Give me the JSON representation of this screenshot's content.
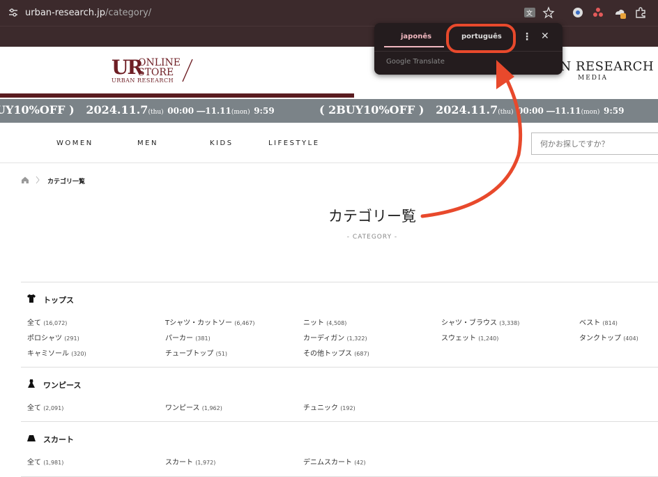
{
  "browser": {
    "url_host": "urban-research.jp",
    "url_path": "/category/"
  },
  "translate_popup": {
    "tab_source": "japonês",
    "tab_target": "português",
    "footer": "Google Translate"
  },
  "header": {
    "logo_ur": "UR",
    "logo_line1": "ONLINE",
    "logo_line2": "STORE",
    "logo_line3": "URBAN RESEARCH",
    "media_title": "AN RESEARCH",
    "media_sub": "MEDIA"
  },
  "banner": {
    "item1_a": "UY10%OFF )",
    "item1_b": "2024.11.7",
    "item1_c": "(thu)",
    "item1_d": "00:00 ―11.11",
    "item1_e": "(mon)",
    "item1_f": "9:59",
    "item2_a": "( 2BUY10%OFF )",
    "item2_b": "2024.11.7",
    "item2_c": "(thu)",
    "item2_d": "00:00 ―11.11",
    "item2_e": "(mon)",
    "item2_f": "9:59"
  },
  "nav": {
    "items": [
      "WOMEN",
      "MEN",
      "KIDS",
      "LIFESTYLE"
    ],
    "search_placeholder": "何かお探しですか？"
  },
  "breadcrumb": {
    "current": "カテゴリ一覧"
  },
  "page": {
    "title": "カテゴリー覧",
    "subtitle": "- CATEGORY -"
  },
  "sections": [
    {
      "title": "トップス",
      "links": [
        {
          "label": "全て",
          "count": "(16,072)"
        },
        {
          "label": "Tシャツ・カットソー",
          "count": "(6,467)"
        },
        {
          "label": "ニット",
          "count": "(4,508)"
        },
        {
          "label": "シャツ・ブラウス",
          "count": "(3,338)"
        },
        {
          "label": "ベスト",
          "count": "(814)"
        },
        {
          "label": "ポロシャツ",
          "count": "(291)"
        },
        {
          "label": "パーカー",
          "count": "(381)"
        },
        {
          "label": "カーディガン",
          "count": "(1,322)"
        },
        {
          "label": "スウェット",
          "count": "(1,240)"
        },
        {
          "label": "タンクトップ",
          "count": "(404)"
        },
        {
          "label": "キャミソール",
          "count": "(320)"
        },
        {
          "label": "チューブトップ",
          "count": "(51)"
        },
        {
          "label": "その他トップス",
          "count": "(687)"
        }
      ]
    },
    {
      "title": "ワンピース",
      "links": [
        {
          "label": "全て",
          "count": "(2,091)"
        },
        {
          "label": "ワンピース",
          "count": "(1,962)"
        },
        {
          "label": "チュニック",
          "count": "(192)"
        }
      ]
    },
    {
      "title": "スカート",
      "links": [
        {
          "label": "全て",
          "count": "(1,981)"
        },
        {
          "label": "スカート",
          "count": "(1,972)"
        },
        {
          "label": "デニムスカート",
          "count": "(42)"
        }
      ]
    }
  ]
}
